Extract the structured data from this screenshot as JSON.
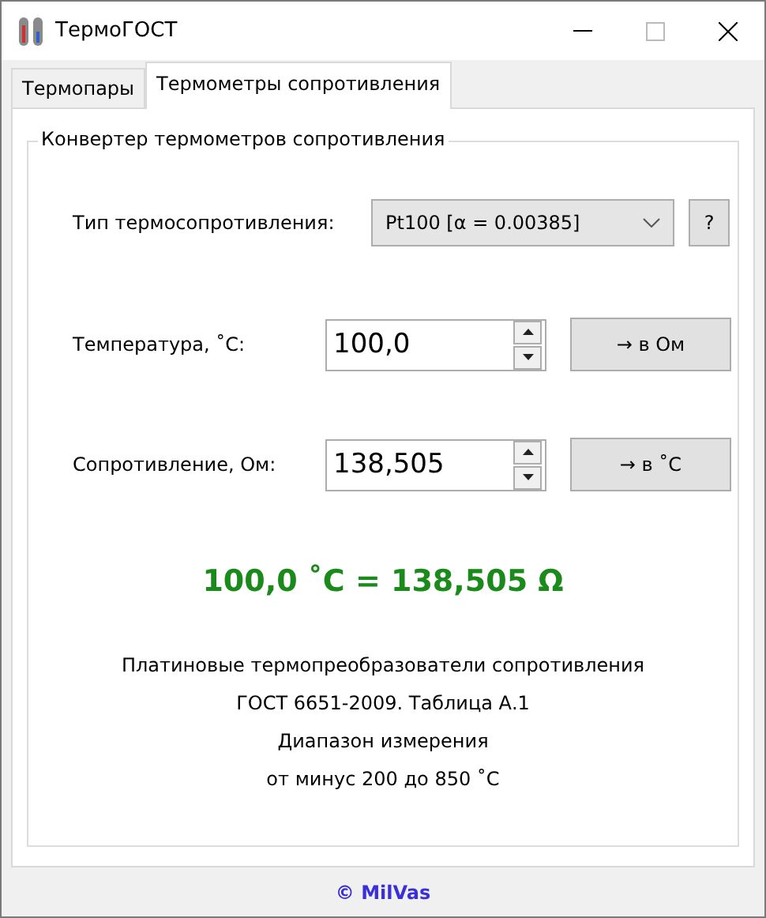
{
  "window": {
    "title": "ТермоГОСТ"
  },
  "tabs": [
    {
      "label": "Термопары",
      "selected": false
    },
    {
      "label": "Термометры сопротивления",
      "selected": true
    }
  ],
  "group": {
    "title": "Конвертер термометров сопротивления"
  },
  "type_row": {
    "label": "Тип термосопротивления:",
    "value": "Pt100 [α = 0.00385]",
    "help": "?"
  },
  "inputs": [
    {
      "label": "Температура, ˚С:",
      "value": "100,0",
      "button": "→ в Ом"
    },
    {
      "label": "Сопротивление, Ом:",
      "value": "138,505",
      "button": "→ в ˚С"
    }
  ],
  "result": "100,0 ˚С = 138,505 Ω",
  "info": [
    "Платиновые термопреобразователи сопротивления",
    "ГОСТ 6651-2009. Таблица А.1",
    "Диапазон измерения",
    "от минус 200 до 850 ˚С"
  ],
  "footer": "© MilVas"
}
